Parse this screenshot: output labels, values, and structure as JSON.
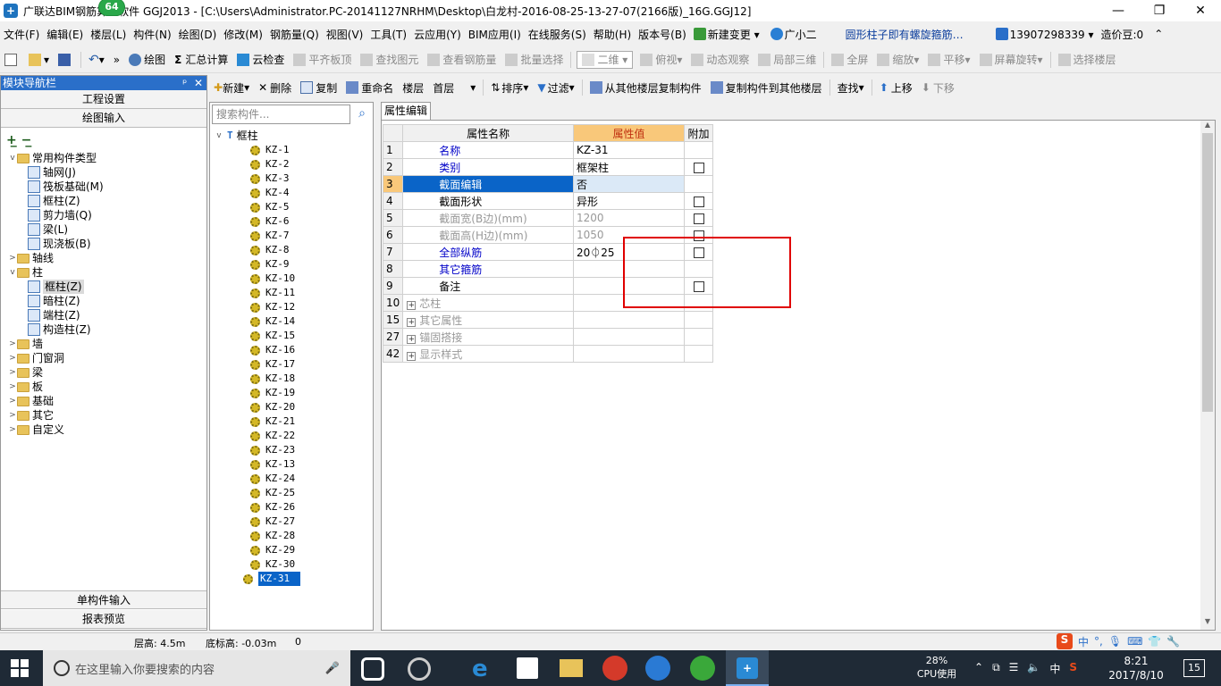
{
  "window": {
    "title": "广联达BIM钢筋算量软件 GGJ2013 - [C:\\Users\\Administrator.PC-20141127NRHM\\Desktop\\白龙村-2016-08-25-13-27-07(2166版)_16G.GGJ12]",
    "badge": "64"
  },
  "menu": [
    "文件(F)",
    "编辑(E)",
    "楼层(L)",
    "构件(N)",
    "绘图(D)",
    "修改(M)",
    "钢筋量(Q)",
    "视图(V)",
    "工具(T)",
    "云应用(Y)",
    "BIM应用(I)",
    "在线服务(S)",
    "帮助(H)",
    "版本号(B)"
  ],
  "menu_right": {
    "new_change": "新建变更",
    "assistant": "广小二",
    "link": "圆形柱子即有螺旋箍筋…",
    "account": "13907298339",
    "beans": "造价豆:0"
  },
  "toolbar1": {
    "draw": "绘图",
    "summary": "汇总计算",
    "cloud_check": "云检查",
    "flat_top": "平齐板顶",
    "find_element": "查找图元",
    "view_rebar": "查看钢筋量",
    "batch_select": "批量选择",
    "view_mode": "二维",
    "top_view": "俯视",
    "dynamic_view": "动态观察",
    "local_3d": "局部三维",
    "fullscreen": "全屏",
    "zoom": "缩放",
    "pan": "平移",
    "rotate": "屏幕旋转",
    "select_floor": "选择楼层"
  },
  "toolbar2": {
    "new": "新建",
    "delete": "删除",
    "copy": "复制",
    "rename": "重命名",
    "floor_label": "楼层",
    "floor_value": "首层",
    "sort": "排序",
    "filter": "过滤",
    "copy_from": "从其他楼层复制构件",
    "copy_to": "复制构件到其他楼层",
    "find": "查找",
    "up": "上移",
    "down": "下移"
  },
  "nav": {
    "header": "模块导航栏",
    "project_settings": "工程设置",
    "drawing_input": "绘图输入",
    "single_input": "单构件输入",
    "report_preview": "报表预览",
    "tree": [
      {
        "level": 0,
        "type": "folder",
        "expand": "v",
        "label": "常用构件类型"
      },
      {
        "level": 1,
        "type": "item",
        "icon": "grid-icon",
        "label": "轴网(J)"
      },
      {
        "level": 1,
        "type": "item",
        "icon": "raft-icon",
        "label": "筏板基础(M)"
      },
      {
        "level": 1,
        "type": "item",
        "icon": "column-icon",
        "label": "框柱(Z)"
      },
      {
        "level": 1,
        "type": "item",
        "icon": "wall-icon",
        "label": "剪力墙(Q)"
      },
      {
        "level": 1,
        "type": "item",
        "icon": "beam-icon",
        "label": "梁(L)"
      },
      {
        "level": 1,
        "type": "item",
        "icon": "slab-icon",
        "label": "现浇板(B)"
      },
      {
        "level": 0,
        "type": "folder",
        "expand": ">",
        "label": "轴线"
      },
      {
        "level": 0,
        "type": "folder",
        "expand": "v",
        "label": "柱"
      },
      {
        "level": 1,
        "type": "item",
        "icon": "column-icon",
        "label": "框柱(Z)",
        "selected": true
      },
      {
        "level": 1,
        "type": "item",
        "icon": "column-icon",
        "label": "暗柱(Z)"
      },
      {
        "level": 1,
        "type": "item",
        "icon": "column-icon",
        "label": "端柱(Z)"
      },
      {
        "level": 1,
        "type": "item",
        "icon": "constructional-column-icon",
        "label": "构造柱(Z)"
      },
      {
        "level": 0,
        "type": "folder",
        "expand": ">",
        "label": "墙"
      },
      {
        "level": 0,
        "type": "folder",
        "expand": ">",
        "label": "门窗洞"
      },
      {
        "level": 0,
        "type": "folder",
        "expand": ">",
        "label": "梁"
      },
      {
        "level": 0,
        "type": "folder",
        "expand": ">",
        "label": "板"
      },
      {
        "level": 0,
        "type": "folder",
        "expand": ">",
        "label": "基础"
      },
      {
        "level": 0,
        "type": "folder",
        "expand": ">",
        "label": "其它"
      },
      {
        "level": 0,
        "type": "folder",
        "expand": ">",
        "label": "自定义"
      }
    ]
  },
  "components": {
    "search_placeholder": "搜索构件...",
    "root": "框柱",
    "items": [
      "KZ-1",
      "KZ-2",
      "KZ-3",
      "KZ-4",
      "KZ-5",
      "KZ-6",
      "KZ-7",
      "KZ-8",
      "KZ-9",
      "KZ-10",
      "KZ-11",
      "KZ-12",
      "KZ-14",
      "KZ-15",
      "KZ-16",
      "KZ-17",
      "KZ-18",
      "KZ-19",
      "KZ-20",
      "KZ-21",
      "KZ-22",
      "KZ-23",
      "KZ-13",
      "KZ-24",
      "KZ-25",
      "KZ-26",
      "KZ-27",
      "KZ-28",
      "KZ-29",
      "KZ-30",
      "KZ-31"
    ],
    "selected": "KZ-31"
  },
  "properties": {
    "tab": "属性编辑",
    "headers": {
      "name": "属性名称",
      "value": "属性值",
      "extra": "附加"
    },
    "rows": [
      {
        "num": "1",
        "name": "名称",
        "value": "KZ-31",
        "style": "blue",
        "check": false,
        "expandable": false
      },
      {
        "num": "2",
        "name": "类别",
        "value": "框架柱",
        "style": "blue",
        "check": true,
        "expandable": false
      },
      {
        "num": "3",
        "name": "截面编辑",
        "value": "否",
        "style": "selected",
        "check": false,
        "expandable": false
      },
      {
        "num": "4",
        "name": "截面形状",
        "value": "异形",
        "style": "black",
        "check": true,
        "expandable": false
      },
      {
        "num": "5",
        "name": "截面宽(B边)(mm)",
        "value": "1200",
        "style": "gray",
        "check": true,
        "expandable": false
      },
      {
        "num": "6",
        "name": "截面高(H边)(mm)",
        "value": "1050",
        "style": "gray",
        "check": true,
        "expandable": false
      },
      {
        "num": "7",
        "name": "全部纵筋",
        "value": "20⏀25",
        "style": "blue",
        "check": true,
        "expandable": false
      },
      {
        "num": "8",
        "name": "其它箍筋",
        "value": "",
        "style": "blue",
        "check": false,
        "expandable": false
      },
      {
        "num": "9",
        "name": "备注",
        "value": "",
        "style": "black",
        "check": true,
        "expandable": false
      },
      {
        "num": "10",
        "name": "芯柱",
        "value": "",
        "style": "gray",
        "check": false,
        "expandable": true
      },
      {
        "num": "15",
        "name": "其它属性",
        "value": "",
        "style": "gray",
        "check": false,
        "expandable": true
      },
      {
        "num": "27",
        "name": "锚固搭接",
        "value": "",
        "style": "gray",
        "check": false,
        "expandable": true
      },
      {
        "num": "42",
        "name": "显示样式",
        "value": "",
        "style": "gray",
        "check": false,
        "expandable": true
      }
    ]
  },
  "status": {
    "floor_height": "层高: 4.5m",
    "bottom_elev": "底标高: -0.03m",
    "count": "0"
  },
  "taskbar": {
    "search_placeholder": "在这里输入你要搜索的内容",
    "cpu_percent": "28%",
    "cpu_label": "CPU使用",
    "ime": "中",
    "time": "8:21",
    "date": "2017/8/10",
    "notifications": "15"
  },
  "colors": {
    "nav_header": "#2a6fc9",
    "highlight_row": "#0a64c8",
    "value_header": "#f9c87a",
    "red_box": "#e00000",
    "taskbar": "#1f2a36"
  }
}
